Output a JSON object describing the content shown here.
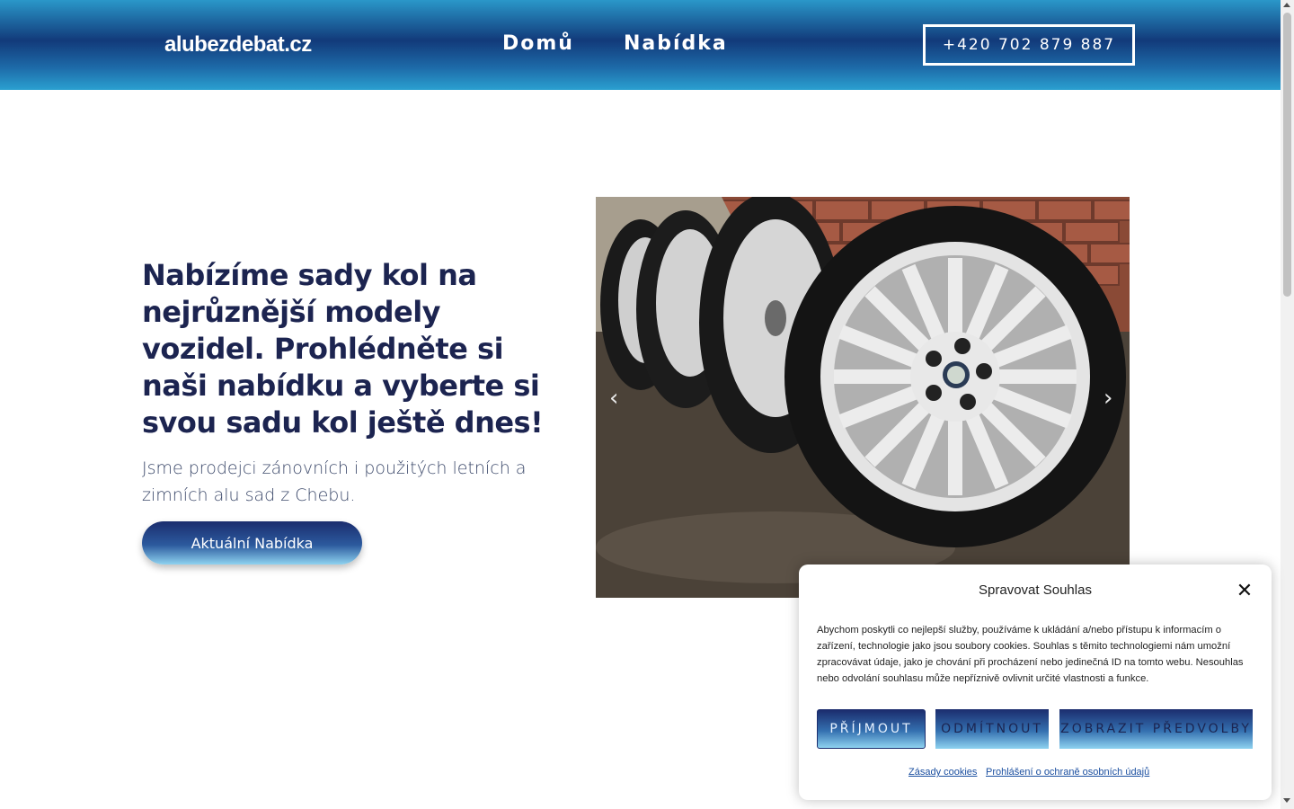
{
  "header": {
    "logo": "alubezdebat.cz",
    "nav": [
      {
        "label": "Domů"
      },
      {
        "label": "Nabídka"
      }
    ],
    "phone": "+420 702 879 887"
  },
  "hero": {
    "title": "Nabízíme sady kol na nejrůznější modely vozidel. Prohlédněte si naši nabídku a vyberte si svou sadu kol ještě dnes!",
    "subtitle": "Jsme prodejci zánovních i použitých letních a zimních alu sad z Chebu.",
    "button": "Aktuální Nabídka"
  },
  "slider": {
    "prev_icon": "chevron-left-icon",
    "next_icon": "chevron-right-icon"
  },
  "cookie": {
    "title": "Spravovat Souhlas",
    "text": "Abychom poskytli co nejlepší služby, používáme k ukládání a/nebo přístupu k informacím o zařízení, technologie jako jsou soubory cookies. Souhlas s těmito technologiemi nám umožní zpracovávat údaje, jako je chování při procházení nebo jedinečná ID na tomto webu. Nesouhlas nebo odvolání souhlasu může nepříznivě ovlivnit určité vlastnosti a funkce.",
    "accept": "PŘÍJMOUT",
    "deny": "ODMÍTNOUT",
    "prefs": "ZOBRAZIT PŘEDVOLBY",
    "link_cookies": "Zásady cookies",
    "link_privacy": "Prohlášení o ochraně osobních údajů"
  },
  "colors": {
    "brand_dark": "#1c2450",
    "header_blue": "#123a7a",
    "accent_light": "#8ed2f0"
  }
}
